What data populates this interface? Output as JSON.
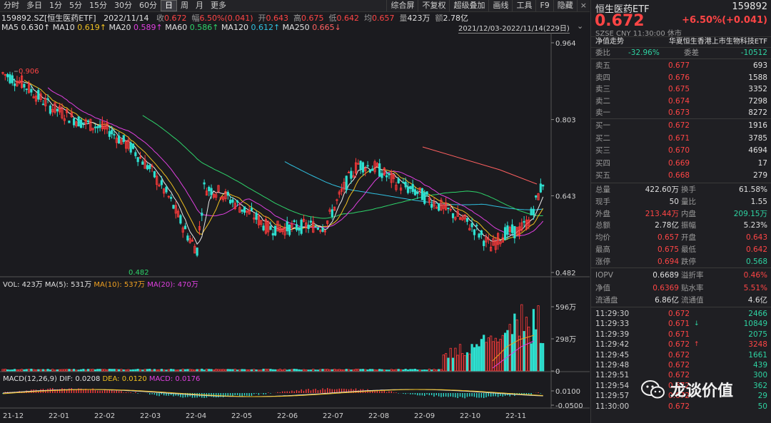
{
  "toolbar": {
    "left_items": [
      "分时",
      "多日",
      "1分",
      "5分",
      "15分",
      "30分",
      "60分",
      "日",
      "周",
      "月",
      "更多"
    ],
    "active": "日",
    "right_items": [
      "综合屏",
      "不复权",
      "超级叠加",
      "画线",
      "工具",
      "F9",
      "隐藏"
    ]
  },
  "info": {
    "code_name": "159892.SZ[恒生医药ETF]",
    "date": "2022/11/14",
    "close_label": "收",
    "close": "0.672",
    "chg_label": "幅",
    "chg": "6.50%(0.041)",
    "open_label": "开",
    "open": "0.643",
    "high_label": "高",
    "high": "0.675",
    "low_label": "低",
    "low": "0.642",
    "avg_label": "均",
    "avg": "0.657",
    "vol_label": "量",
    "vol": "423万",
    "amt_label": "额",
    "amt": "2.78亿"
  },
  "ma_line": [
    {
      "label": "MA5",
      "value": "0.630↑",
      "color": "#e8e8e8"
    },
    {
      "label": "MA10",
      "value": "0.619↑",
      "color": "#f0c020"
    },
    {
      "label": "MA20",
      "value": "0.589↑",
      "color": "#e040e0"
    },
    {
      "label": "MA60",
      "value": "0.586↑",
      "color": "#2ed36a"
    },
    {
      "label": "MA120",
      "value": "0.612↑",
      "color": "#30c0e0"
    },
    {
      "label": "MA250",
      "value": "0.665↓",
      "color": "#ff6060"
    }
  ],
  "range": "2021/12/03-2022/11/14(229日)",
  "price_axis": [
    "0.964",
    "0.803",
    "0.643",
    "0.482"
  ],
  "annotations": {
    "high": "0.906",
    "low": "0.482"
  },
  "vol_header": [
    {
      "label": "VOL: 423万",
      "color": "#e0e0e0"
    },
    {
      "label": "MA(5): 531万",
      "color": "#e0e0e0"
    },
    {
      "label": "MA(10): 537万",
      "color": "#f0a020"
    },
    {
      "label": "MA(20): 470万",
      "color": "#e040e0"
    }
  ],
  "vol_axis": [
    "596万",
    "298万",
    "0"
  ],
  "macd_header": [
    {
      "label": "MACD(12,26,9)",
      "color": "#e0e0e0"
    },
    {
      "label": "DIF: 0.0208",
      "color": "#e0e0e0"
    },
    {
      "label": "DEA: 0.0120",
      "color": "#f0c020"
    },
    {
      "label": "MACD: 0.0176",
      "color": "#e040e0"
    }
  ],
  "macd_axis": [
    "0.0100",
    "-0.0500"
  ],
  "date_axis": [
    "21-12",
    "22-01",
    "22-02",
    "22-03",
    "22-04",
    "22-05",
    "22-06",
    "22-07",
    "22-08",
    "22-09",
    "22-10",
    "22-11"
  ],
  "side": {
    "name": "恒生医药ETF",
    "code": "159892",
    "price": "0.672",
    "change": "+6.50%(+0.041)",
    "sub": "SZSE  CNY  11:30:00  休市",
    "nav_label": "净值走势",
    "nav_name": "华夏恒生香港上市生物科技ETF",
    "weibi_label": "委比",
    "weibi": "-32.96%",
    "weicha_label": "委差",
    "weicha": "-10512",
    "asks": [
      {
        "label": "卖五",
        "price": "0.677",
        "vol": "693"
      },
      {
        "label": "卖四",
        "price": "0.676",
        "vol": "1588"
      },
      {
        "label": "卖三",
        "price": "0.675",
        "vol": "3352"
      },
      {
        "label": "卖二",
        "price": "0.674",
        "vol": "7298"
      },
      {
        "label": "卖一",
        "price": "0.673",
        "vol": "8272"
      }
    ],
    "bids": [
      {
        "label": "买一",
        "price": "0.672",
        "vol": "1916"
      },
      {
        "label": "买二",
        "price": "0.671",
        "vol": "3785"
      },
      {
        "label": "买三",
        "price": "0.670",
        "vol": "4694"
      },
      {
        "label": "买四",
        "price": "0.669",
        "vol": "17"
      },
      {
        "label": "买五",
        "price": "0.668",
        "vol": "279"
      }
    ],
    "stats": [
      {
        "l1": "总量",
        "v1": "422.60万",
        "c1": "#e0e0e0",
        "l2": "换手",
        "v2": "61.58%",
        "c2": "#e0e0e0"
      },
      {
        "l1": "现手",
        "v1": "50",
        "c1": "#e0e0e0",
        "l2": "量比",
        "v2": "1.55",
        "c2": "#e0e0e0"
      },
      {
        "l1": "外盘",
        "v1": "213.44万",
        "c1": "#ff4545",
        "l2": "内盘",
        "v2": "209.15万",
        "c2": "#2ed3a2"
      },
      {
        "l1": "总额",
        "v1": "2.78亿",
        "c1": "#e0e0e0",
        "l2": "振幅",
        "v2": "5.23%",
        "c2": "#e0e0e0"
      },
      {
        "l1": "均价",
        "v1": "0.657",
        "c1": "#ff4545",
        "l2": "开盘",
        "v2": "0.643",
        "c2": "#ff4545"
      },
      {
        "l1": "最高",
        "v1": "0.675",
        "c1": "#ff4545",
        "l2": "最低",
        "v2": "0.642",
        "c2": "#ff4545"
      },
      {
        "l1": "涨停",
        "v1": "0.694",
        "c1": "#ff4545",
        "l2": "跌停",
        "v2": "0.568",
        "c2": "#2ed3a2"
      }
    ],
    "etf": [
      {
        "l1": "IOPV",
        "v1": "0.6689",
        "c1": "#e0e0e0",
        "l2": "溢折率",
        "v2": "0.46%",
        "c2": "#ff4545"
      },
      {
        "l1": "净值",
        "v1": "0.6369",
        "c1": "#ff4545",
        "l2": "贴水率",
        "v2": "5.51%",
        "c2": "#ff4545"
      },
      {
        "l1": "流通盘",
        "v1": "6.86亿",
        "c1": "#e0e0e0",
        "l2": "流通值",
        "v2": "4.6亿",
        "c2": "#e0e0e0"
      }
    ],
    "ticks": [
      {
        "time": "11:29:30",
        "price": "0.672",
        "arrow": "",
        "vol": "2466",
        "vc": "#2ed3a2"
      },
      {
        "time": "11:29:33",
        "price": "0.671",
        "arrow": "↓",
        "vol": "10849",
        "vc": "#2ed3a2"
      },
      {
        "time": "11:29:39",
        "price": "0.671",
        "arrow": "",
        "vol": "2075",
        "vc": "#2ed3a2"
      },
      {
        "time": "11:29:42",
        "price": "0.672",
        "arrow": "↑",
        "vol": "3248",
        "vc": "#ff4545"
      },
      {
        "time": "11:29:45",
        "price": "0.672",
        "arrow": "",
        "vol": "1661",
        "vc": "#2ed3a2"
      },
      {
        "time": "11:29:48",
        "price": "0.672",
        "arrow": "",
        "vol": "439",
        "vc": "#2ed3a2"
      },
      {
        "time": "11:29:51",
        "price": "0.672",
        "arrow": "",
        "vol": "300",
        "vc": "#2ed3a2"
      },
      {
        "time": "11:29:54",
        "price": "0.672",
        "arrow": "",
        "vol": "362",
        "vc": "#2ed3a2"
      },
      {
        "time": "11:29:57",
        "price": "0.672",
        "arrow": "",
        "vol": "29",
        "vc": "#2ed3a2"
      },
      {
        "time": "11:30:00",
        "price": "0.672",
        "arrow": "",
        "vol": "50",
        "vc": "#2ed3a2"
      }
    ]
  },
  "watermark": "龙谈价值"
}
